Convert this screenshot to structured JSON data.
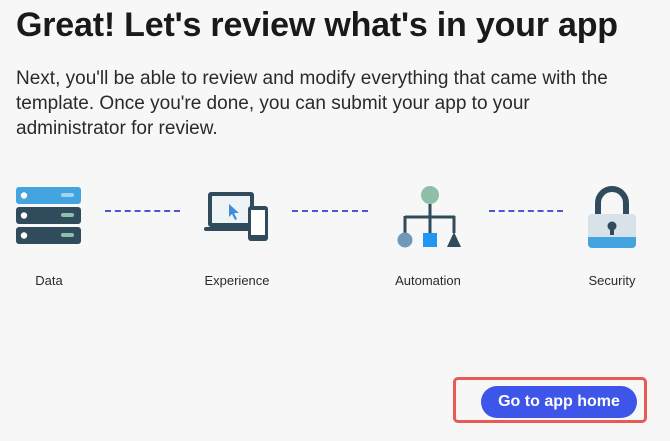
{
  "header": {
    "title": "Great! Let's review what's in your app",
    "description": "Next, you'll be able to review and modify everything that came with the template. Once you're done, you can submit your app to your administrator for review."
  },
  "steps": [
    {
      "label": "Data",
      "icon": "database-icon"
    },
    {
      "label": "Experience",
      "icon": "devices-icon"
    },
    {
      "label": "Automation",
      "icon": "workflow-icon"
    },
    {
      "label": "Security",
      "icon": "lock-icon"
    }
  ],
  "actions": {
    "primary_label": "Go to app home"
  },
  "colors": {
    "accent": "#3d55e8",
    "connector": "#4a57d6",
    "highlight": "#e85a55",
    "data_dark": "#2f4b5c",
    "data_light": "#43a4e0",
    "teal": "#8fbfa9"
  }
}
